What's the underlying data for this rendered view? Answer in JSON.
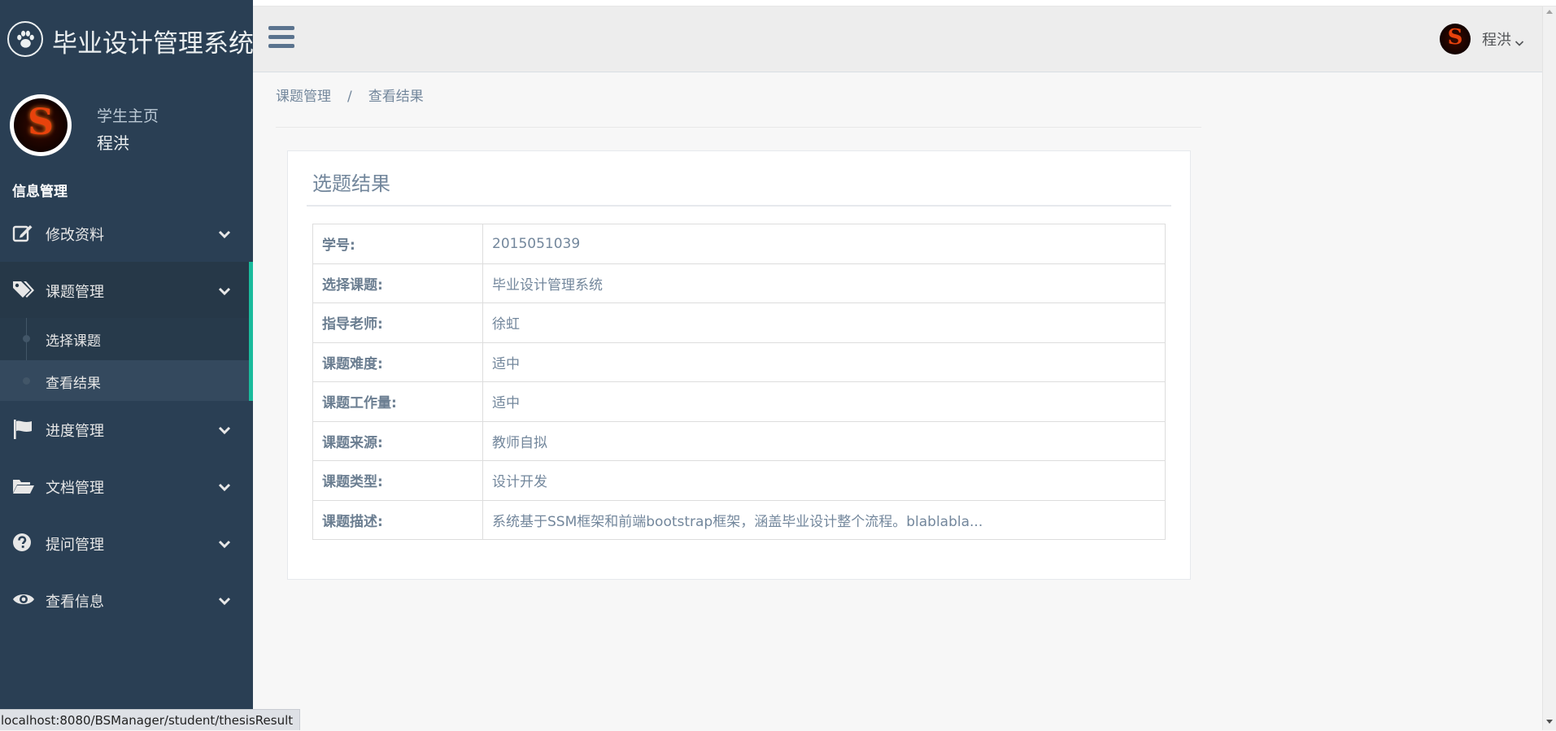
{
  "app": {
    "title": "毕业设计管理系统",
    "logo_icon": "paw-icon"
  },
  "profile": {
    "welcome": "学生主页",
    "name": "程洪",
    "avatar_letter": "S"
  },
  "sidebar": {
    "section_title": "信息管理",
    "items": [
      {
        "label": "修改资料",
        "icon": "edit-icon"
      },
      {
        "label": "课题管理",
        "icon": "tags-icon",
        "active": true
      },
      {
        "label": "进度管理",
        "icon": "flag-icon"
      },
      {
        "label": "文档管理",
        "icon": "folder-open-icon"
      },
      {
        "label": "提问管理",
        "icon": "question-circle-icon"
      },
      {
        "label": "查看信息",
        "icon": "eye-icon"
      }
    ],
    "submenu": [
      {
        "label": "选择课题"
      },
      {
        "label": "查看结果",
        "current": true
      }
    ]
  },
  "topnav": {
    "user_name": "程洪",
    "avatar_letter": "S"
  },
  "breadcrumb": {
    "items": [
      "课题管理",
      "查看结果"
    ],
    "separator": "/"
  },
  "panel": {
    "title": "选题结果",
    "rows": [
      {
        "key": "学号:",
        "value": "2015051039"
      },
      {
        "key": "选择课题:",
        "value": "毕业设计管理系统"
      },
      {
        "key": "指导老师:",
        "value": "徐虹"
      },
      {
        "key": "课题难度:",
        "value": "适中"
      },
      {
        "key": "课题工作量:",
        "value": "适中"
      },
      {
        "key": "课题来源:",
        "value": "教师自拟"
      },
      {
        "key": "课题类型:",
        "value": "设计开发"
      },
      {
        "key": "课题描述:",
        "value": "系统基于SSM框架和前端bootstrap框架，涵盖毕业设计整个流程。blablabla..."
      }
    ]
  },
  "statusbar": {
    "url": "localhost:8080/BSManager/student/thesisResult"
  },
  "colors": {
    "sidebar_bg": "#2a3f54",
    "accent": "#1abb9c",
    "text": "#73879c"
  }
}
